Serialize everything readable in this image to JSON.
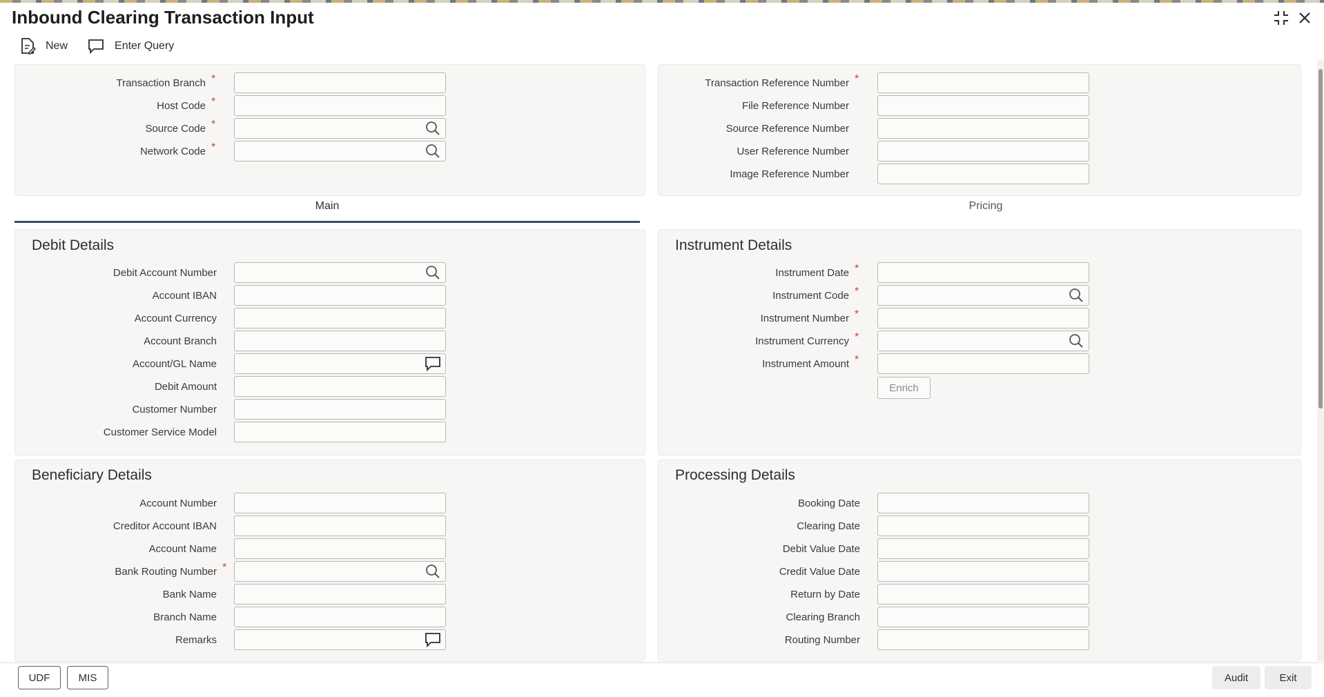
{
  "window": {
    "title": "Inbound Clearing Transaction Input"
  },
  "toolbar": {
    "new_label": "New",
    "enter_query_label": "Enter Query"
  },
  "header_left": {
    "fields": [
      {
        "label": "Transaction Branch",
        "required": true,
        "value": ""
      },
      {
        "label": "Host Code",
        "required": true,
        "value": ""
      },
      {
        "label": "Source Code",
        "required": true,
        "value": "",
        "icon": "search-icon"
      },
      {
        "label": "Network Code",
        "required": true,
        "value": "",
        "icon": "search-icon"
      }
    ]
  },
  "header_right": {
    "fields": [
      {
        "label": "Transaction Reference Number",
        "required": true,
        "value": ""
      },
      {
        "label": "File Reference Number",
        "required": false,
        "value": ""
      },
      {
        "label": "Source Reference Number",
        "required": false,
        "value": ""
      },
      {
        "label": "User Reference Number",
        "required": false,
        "value": ""
      },
      {
        "label": "Image Reference Number",
        "required": false,
        "value": ""
      }
    ]
  },
  "tabs": [
    {
      "label": "Main",
      "active": true
    },
    {
      "label": "Pricing",
      "active": false
    }
  ],
  "debit_details": {
    "title": "Debit Details",
    "fields": [
      {
        "label": "Debit Account Number",
        "value": "",
        "icon": "search-icon"
      },
      {
        "label": "Account IBAN",
        "value": ""
      },
      {
        "label": "Account Currency",
        "value": ""
      },
      {
        "label": "Account Branch",
        "value": ""
      },
      {
        "label": "Account/GL Name",
        "value": "",
        "icon": "comment-icon"
      },
      {
        "label": "Debit Amount",
        "value": ""
      },
      {
        "label": "Customer Number",
        "value": ""
      },
      {
        "label": "Customer Service Model",
        "value": ""
      }
    ]
  },
  "instrument_details": {
    "title": "Instrument Details",
    "fields": [
      {
        "label": "Instrument Date",
        "required": true,
        "value": ""
      },
      {
        "label": "Instrument Code",
        "required": true,
        "value": "",
        "icon": "search-icon"
      },
      {
        "label": "Instrument Number",
        "required": true,
        "value": ""
      },
      {
        "label": "Instrument Currency",
        "required": true,
        "value": "",
        "icon": "search-icon"
      },
      {
        "label": "Instrument Amount",
        "required": true,
        "value": ""
      }
    ],
    "enrich_label": "Enrich"
  },
  "beneficiary_details": {
    "title": "Beneficiary Details",
    "fields": [
      {
        "label": "Account Number",
        "value": ""
      },
      {
        "label": "Creditor Account IBAN",
        "value": ""
      },
      {
        "label": "Account Name",
        "value": ""
      },
      {
        "label": "Bank Routing Number",
        "required": true,
        "value": "",
        "icon": "search-icon"
      },
      {
        "label": "Bank Name",
        "value": ""
      },
      {
        "label": "Branch Name",
        "value": ""
      },
      {
        "label": "Remarks",
        "value": "",
        "icon": "comment-icon"
      }
    ]
  },
  "processing_details": {
    "title": "Processing Details",
    "fields": [
      {
        "label": "Booking Date",
        "value": ""
      },
      {
        "label": "Clearing Date",
        "value": ""
      },
      {
        "label": "Debit Value Date",
        "value": ""
      },
      {
        "label": "Credit Value Date",
        "value": ""
      },
      {
        "label": "Return by Date",
        "value": ""
      },
      {
        "label": "Clearing Branch",
        "value": ""
      },
      {
        "label": "Routing Number",
        "value": ""
      }
    ]
  },
  "footer": {
    "udf_label": "UDF",
    "mis_label": "MIS",
    "audit_label": "Audit",
    "exit_label": "Exit"
  },
  "colors": {
    "accent": "#3d4b63",
    "required": "#c74634",
    "panel": "#f7f6f4"
  }
}
